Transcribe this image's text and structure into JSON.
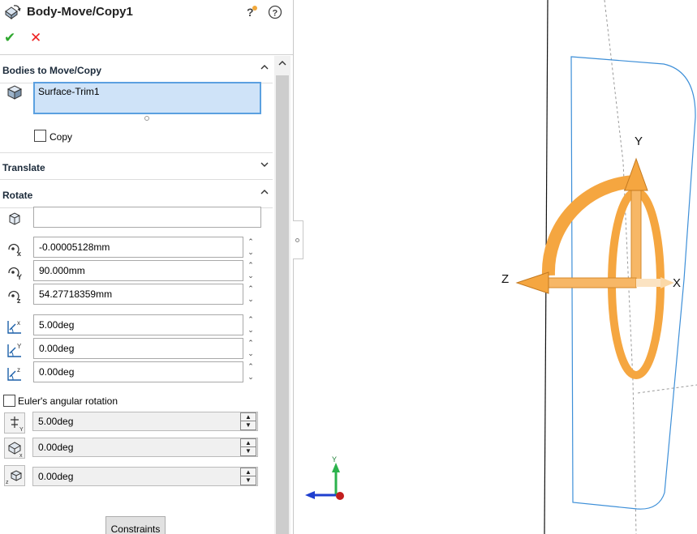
{
  "header": {
    "title": "Body-Move/Copy1",
    "title_icon": "body-move-icon",
    "help_icon": "help-icon",
    "whats_new_icon": "whats-new-icon",
    "ok_icon": "checkmark-icon",
    "cancel_icon": "x-icon",
    "ok_glyph": "✔",
    "cancel_glyph": "✕"
  },
  "bodies_section": {
    "label": "Bodies to Move/Copy",
    "selected_items": [
      "Surface-Trim1"
    ],
    "copy_label": "Copy",
    "copy_checked": false
  },
  "translate_section": {
    "label": "Translate"
  },
  "rotate_section": {
    "label": "Rotate",
    "reference_value": "",
    "x_origin": "-0.00005128mm",
    "y_origin": "90.000mm",
    "z_origin": "54.27718359mm",
    "x_angle": "5.00deg",
    "y_angle": "0.00deg",
    "z_angle": "0.00deg",
    "euler_label": "Euler's angular rotation",
    "euler_checked": false,
    "euler_1": "5.00deg",
    "euler_2": "0.00deg",
    "euler_3": "0.00deg",
    "spin_up": "⌃",
    "spin_down": "⌄",
    "spin_box_up": "▲",
    "spin_box_down": "▼"
  },
  "constraints_button": "Constraints",
  "viewport": {
    "triad_labels": {
      "y": "Y",
      "z": "Z",
      "x": "X"
    },
    "mini_triad_labels": {
      "y": "Y",
      "z": "Z"
    },
    "colors": {
      "triad_orange": "#f5a640",
      "surface_edge": "#3d8fd8",
      "mini_y": "#2bb24c",
      "mini_z": "#1f3fcf",
      "mini_origin": "#c21e1e"
    }
  }
}
